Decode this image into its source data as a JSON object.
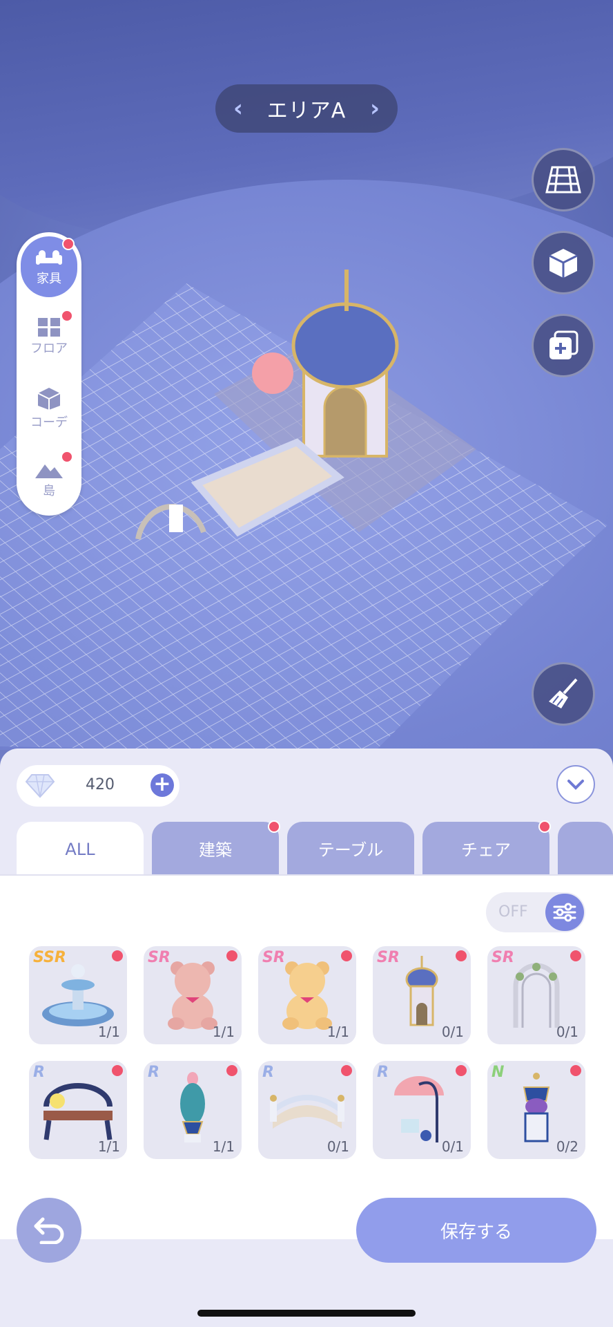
{
  "area": {
    "name": "エリアA"
  },
  "sidebar": {
    "items": [
      {
        "label": "家具",
        "icon": "sofa-icon",
        "active": true,
        "badge": true
      },
      {
        "label": "フロア",
        "icon": "floor-icon",
        "active": false,
        "badge": true
      },
      {
        "label": "コーデ",
        "icon": "cube-icon",
        "active": false,
        "badge": false
      },
      {
        "label": "島",
        "icon": "island-icon",
        "active": false,
        "badge": true
      }
    ]
  },
  "right_buttons": [
    "grid-icon",
    "cube-view-icon",
    "copy-add-icon",
    "broom-icon"
  ],
  "panel": {
    "gem_count": "420",
    "tabs": [
      {
        "label": "ALL",
        "active": true,
        "badge": false
      },
      {
        "label": "建築",
        "active": false,
        "badge": true
      },
      {
        "label": "テーブル",
        "active": false,
        "badge": false
      },
      {
        "label": "チェア",
        "active": false,
        "badge": true
      },
      {
        "label": "",
        "active": false,
        "badge": false
      }
    ],
    "filter_toggle": "OFF",
    "items": [
      {
        "rarity": "SSR",
        "count": "1/1",
        "icon": "fountain-icon"
      },
      {
        "rarity": "SR",
        "count": "1/1",
        "icon": "pink-bear-icon"
      },
      {
        "rarity": "SR",
        "count": "1/1",
        "icon": "yellow-bear-icon"
      },
      {
        "rarity": "SR",
        "count": "0/1",
        "icon": "tower-icon"
      },
      {
        "rarity": "SR",
        "count": "0/1",
        "icon": "arch-icon"
      },
      {
        "rarity": "R",
        "count": "1/1",
        "icon": "bench-icon"
      },
      {
        "rarity": "R",
        "count": "1/1",
        "icon": "vase-icon"
      },
      {
        "rarity": "R",
        "count": "0/1",
        "icon": "bridge-icon"
      },
      {
        "rarity": "R",
        "count": "0/1",
        "icon": "umbrella-icon"
      },
      {
        "rarity": "N",
        "count": "0/2",
        "icon": "lamp-pillar-icon"
      }
    ],
    "save_label": "保存する"
  },
  "colors": {
    "accent": "#7f8de6",
    "badge": "#f0536d",
    "ssr": "#f6b13c",
    "sr": "#f07fb0",
    "r": "#9aaee6",
    "n": "#8cd07a"
  }
}
